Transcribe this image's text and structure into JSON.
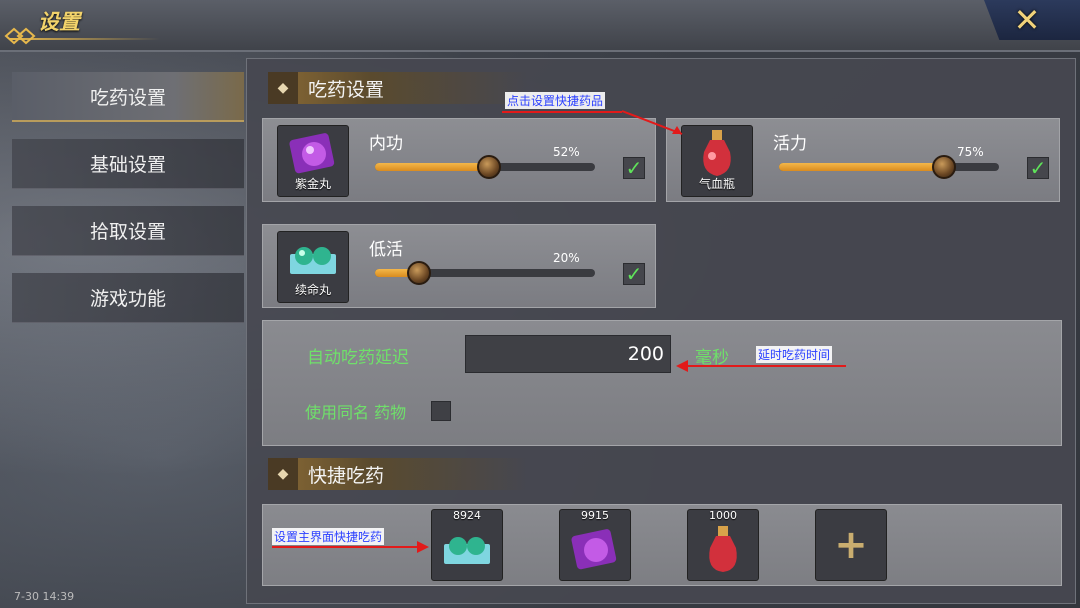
{
  "window": {
    "title": "设置",
    "close_label": "✕"
  },
  "nav": {
    "items": [
      {
        "label": "吃药设置",
        "active": true
      },
      {
        "label": "基础设置",
        "active": false
      },
      {
        "label": "拾取设置",
        "active": false
      },
      {
        "label": "游戏功能",
        "active": false
      }
    ]
  },
  "sections": {
    "medicine": "吃药设置",
    "quick": "快捷吃药"
  },
  "medicine_cards": [
    {
      "item": "紫金丸",
      "stat": "内功",
      "percent_label": "52%",
      "percent": 52,
      "checked": true,
      "item_color": "#b54bd9"
    },
    {
      "item": "气血瓶",
      "stat": "活力",
      "percent_label": "75%",
      "percent": 75,
      "checked": true,
      "item_color": "#e0404a"
    },
    {
      "item": "续命丸",
      "stat": "低活",
      "percent_label": "20%",
      "percent": 20,
      "checked": true,
      "item_color": "#3bc9a8"
    }
  ],
  "delay": {
    "label": "自动吃药延迟",
    "value": "200",
    "unit": "毫秒",
    "same_name_label": "使用同名 药物"
  },
  "quick_slots": [
    {
      "count": "8924",
      "icon": "jade-pill-icon",
      "color": "#3bc9a8"
    },
    {
      "count": "9915",
      "icon": "purple-pill-icon",
      "color": "#b54bd9"
    },
    {
      "count": "1000",
      "icon": "red-potion-icon",
      "color": "#e0404a"
    },
    {
      "count": "",
      "icon": "plus-icon",
      "color": "#c9ad6f"
    }
  ],
  "annotations": {
    "click_note": "点击设置快捷药品",
    "delay_note": "延时吃药时间",
    "quick_note": "设置主界面快捷吃药"
  },
  "status": {
    "time": "7-30 14:39"
  },
  "colors": {
    "accent_gold": "#e7b84c",
    "green_text": "#6fe06a",
    "annotation_blue": "#2a3fff",
    "annotation_red": "#e21a1a"
  }
}
